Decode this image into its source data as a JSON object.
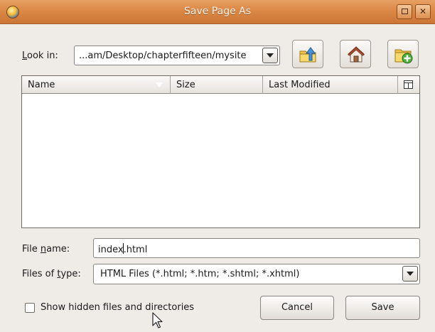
{
  "window": {
    "title": "Save Page As",
    "maximize_icon": "maximize-icon",
    "close_glyph": "✕"
  },
  "look_in": {
    "label_pre": "",
    "label_accel": "L",
    "label_post": "ook in:",
    "value": "...am/Desktop/chapterfifteen/mysite"
  },
  "toolbar_icons": [
    "folder-up-icon",
    "home-icon",
    "new-folder-icon"
  ],
  "file_list": {
    "columns": [
      "Name",
      "Size",
      "Last Modified"
    ],
    "rows": []
  },
  "file_name": {
    "label_pre": "File ",
    "label_accel": "n",
    "label_post": "ame:",
    "value_before_cursor": "index",
    "value_after_cursor": ".html"
  },
  "file_type": {
    "label_pre": "Files of ",
    "label_accel": "t",
    "label_post": "ype:",
    "selected": "HTML Files (*.html; *.htm; *.shtml; *.xhtml)"
  },
  "options": {
    "show_hidden_label": "Show hidden files and directories",
    "show_hidden_checked": false
  },
  "buttons": {
    "cancel": "Cancel",
    "save": "Save"
  },
  "colors": {
    "titlebar": "#dc8a48",
    "window_bg": "#efebe7"
  }
}
